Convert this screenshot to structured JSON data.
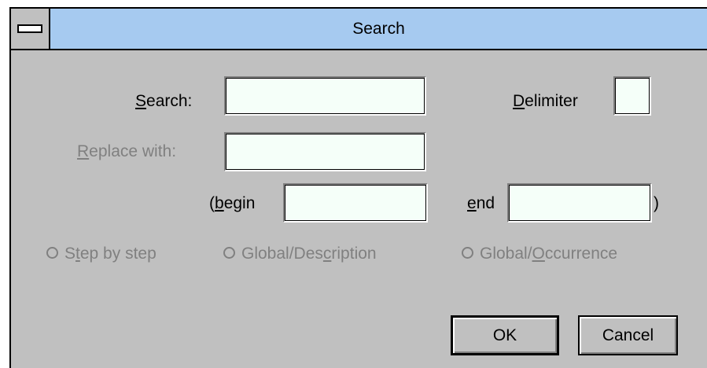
{
  "dialog": {
    "title": "Search",
    "system_menu_icon": "system-menu-icon"
  },
  "search": {
    "label_mnemonic": "S",
    "label_rest": "earch:",
    "value": ""
  },
  "delimiter": {
    "label_mnemonic": "D",
    "label_rest": "elimiter",
    "value": ""
  },
  "replace": {
    "label_mnemonic": "R",
    "label_rest": "eplace with:",
    "value": "",
    "disabled": true
  },
  "begin": {
    "label_prefix": "(",
    "label_mnemonic": "b",
    "label_rest": "egin",
    "value": ""
  },
  "end": {
    "label_mnemonic": "e",
    "label_rest": "nd",
    "suffix": ")",
    "value": ""
  },
  "options": [
    {
      "pre": "S",
      "mnemonic": "t",
      "post": "ep by step",
      "selected": false,
      "disabled": true
    },
    {
      "pre": "Global/Des",
      "mnemonic": "c",
      "post": "ription",
      "selected": false,
      "disabled": true
    },
    {
      "pre": "Global/",
      "mnemonic": "O",
      "post": "ccurrence",
      "selected": false,
      "disabled": true
    }
  ],
  "buttons": {
    "ok": "OK",
    "cancel": "Cancel"
  },
  "colors": {
    "dialog_bg": "#c0c0c0",
    "titlebar": "#a6caf0",
    "field_bg": "#f5fff9",
    "disabled_text": "#808080"
  }
}
